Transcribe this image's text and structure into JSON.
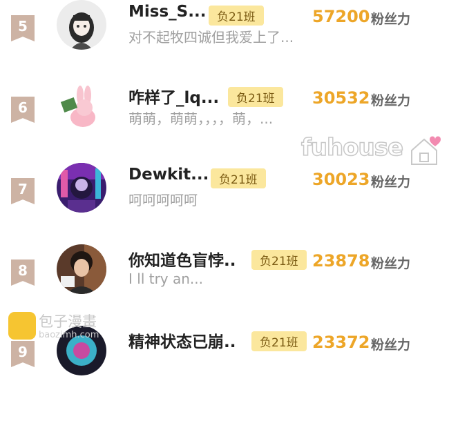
{
  "rows": [
    {
      "rank": "5",
      "name": "Miss_S...",
      "badge": "负21班",
      "sub": "对不起牧四诚但我爱上了...",
      "count": "57200",
      "unit": "粉丝力"
    },
    {
      "rank": "6",
      "name": "咋样了_lq...",
      "badge": "负21班",
      "sub": "萌萌，萌萌，，，，萌，...",
      "count": "30532",
      "unit": "粉丝力"
    },
    {
      "rank": "7",
      "name": "Dewkit...",
      "badge": "负21班",
      "sub": "呵呵呵呵呵",
      "count": "30023",
      "unit": "粉丝力"
    },
    {
      "rank": "8",
      "name": "你知道色盲悖..",
      "badge": "负21班",
      "sub": "I ll try an...",
      "count": "23878",
      "unit": "粉丝力"
    },
    {
      "rank": "9",
      "name": "精神状态已崩..",
      "badge": "负21班",
      "sub": "",
      "count": "23372",
      "unit": "粉丝力"
    }
  ],
  "watermark": {
    "text": "fuhouse"
  },
  "site_badge": {
    "name": "包子漫畫",
    "url": "baozimh.com"
  },
  "colors": {
    "count": "#eda628",
    "badge_bg": "#fbe79d",
    "rank_bg": "#cdb3a4",
    "heart": "#f28ab0"
  }
}
